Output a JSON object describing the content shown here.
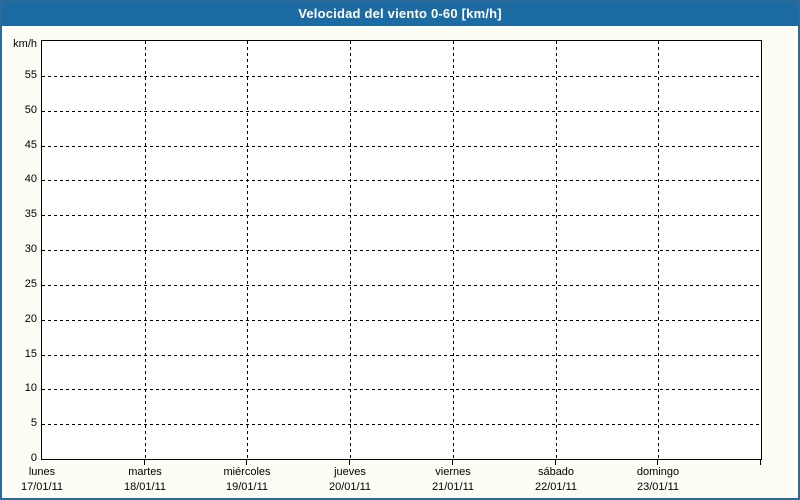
{
  "window": {
    "title": "Velocidad del viento 0-60 [km/h]",
    "colors": {
      "titlebar_bg": "#1d6ba3",
      "titlebar_text": "#ffffff",
      "frame_border": "#2c6b99",
      "background": "#fcfef5",
      "plot_background": "#fffffe",
      "grid_color": "#000000",
      "label_color": "#000000"
    }
  },
  "chart_data": {
    "type": "line",
    "title": "Velocidad del viento 0-60 [km/h]",
    "xlabel": "",
    "ylabel": "km/h",
    "ylim": [
      0,
      60
    ],
    "ytick_interval": 5,
    "ytick_labels": [
      "0",
      "5",
      "10",
      "15",
      "20",
      "25",
      "30",
      "35",
      "40",
      "45",
      "50",
      "55"
    ],
    "categories": [
      {
        "day": "lunes",
        "date": "17/01/11"
      },
      {
        "day": "martes",
        "date": "18/01/11"
      },
      {
        "day": "miércoles",
        "date": "19/01/11"
      },
      {
        "day": "jueves",
        "date": "20/01/11"
      },
      {
        "day": "viernes",
        "date": "21/01/11"
      },
      {
        "day": "sábado",
        "date": "22/01/11"
      },
      {
        "day": "domingo",
        "date": "23/01/11"
      }
    ],
    "series": [],
    "grid": {
      "style": "dashed",
      "horizontal_step": 5,
      "vertical_per_day": true
    },
    "legend": null,
    "note": "no data series plotted; empty forecast grid"
  }
}
